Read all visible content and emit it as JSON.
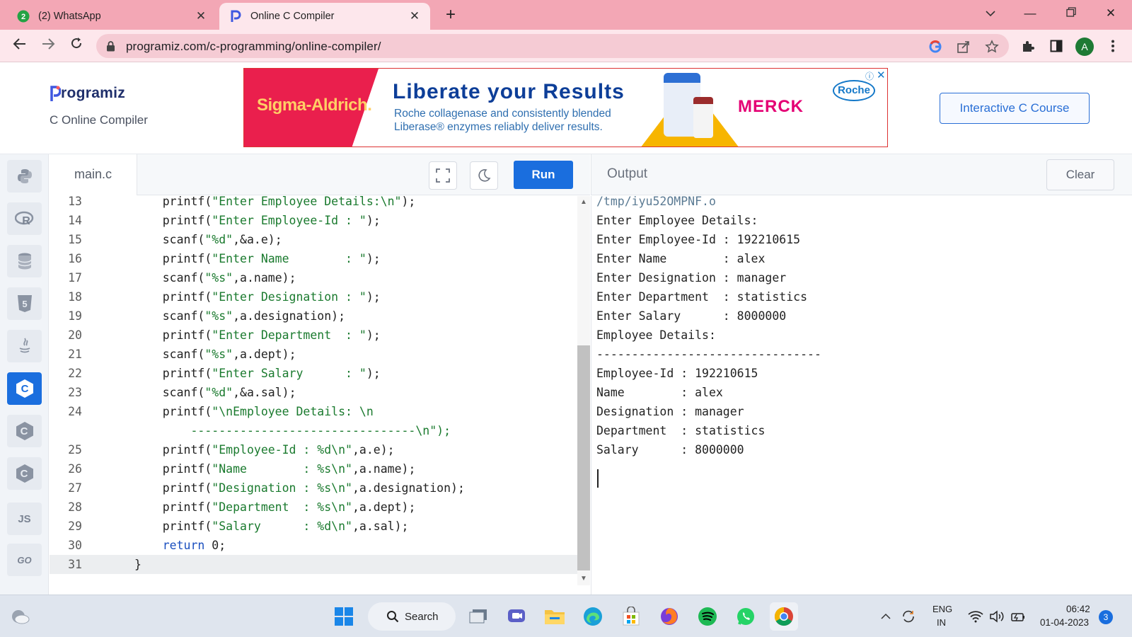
{
  "browser": {
    "tabs": [
      {
        "badge": "2",
        "title": "(2) WhatsApp"
      },
      {
        "title": "Online C Compiler"
      }
    ],
    "url": "programiz.com/c-programming/online-compiler/",
    "profile_initial": "A"
  },
  "site": {
    "logo_text": "rogramiz",
    "logo_letter": "P",
    "subtitle": "C Online Compiler",
    "course_button": "Interactive C Course",
    "ad": {
      "brand_left": "Sigma-Aldrich.",
      "headline": "Liberate your Results",
      "line1": "Roche collagenase and consistently blended",
      "line2": "Liberase® enzymes reliably deliver results.",
      "brand_right": "MERCK",
      "roche": "Roche"
    }
  },
  "sidebar": {
    "items": [
      {
        "name": "python",
        "label": ""
      },
      {
        "name": "r",
        "label": "R"
      },
      {
        "name": "sql",
        "label": ""
      },
      {
        "name": "html",
        "label": "5"
      },
      {
        "name": "java",
        "label": ""
      },
      {
        "name": "c",
        "label": "C",
        "active": true
      },
      {
        "name": "cpp",
        "label": "C"
      },
      {
        "name": "csharp",
        "label": "C"
      },
      {
        "name": "js",
        "label": "JS"
      },
      {
        "name": "go",
        "label": "GO"
      }
    ]
  },
  "editor": {
    "file_name": "main.c",
    "run_label": "Run",
    "lines": [
      {
        "n": "13",
        "code": "    printf(\"Enter Employee Details:\\n\");"
      },
      {
        "n": "14",
        "code": "    printf(\"Enter Employee-Id : \");"
      },
      {
        "n": "15",
        "code": "    scanf(\"%d\",&a.e);"
      },
      {
        "n": "16",
        "code": "    printf(\"Enter Name        : \");"
      },
      {
        "n": "17",
        "code": "    scanf(\"%s\",a.name);"
      },
      {
        "n": "18",
        "code": "    printf(\"Enter Designation : \");"
      },
      {
        "n": "19",
        "code": "    scanf(\"%s\",a.designation);"
      },
      {
        "n": "20",
        "code": "    printf(\"Enter Department  : \");"
      },
      {
        "n": "21",
        "code": "    scanf(\"%s\",a.dept);"
      },
      {
        "n": "22",
        "code": "    printf(\"Enter Salary      : \");"
      },
      {
        "n": "23",
        "code": "    scanf(\"%d\",&a.sal);"
      },
      {
        "n": "24",
        "code": "    printf(\"\\nEmployee Details: \\n"
      },
      {
        "n": "",
        "code": "        --------------------------------\\n\");"
      },
      {
        "n": "25",
        "code": "    printf(\"Employee-Id : %d\\n\",a.e);"
      },
      {
        "n": "26",
        "code": "    printf(\"Name        : %s\\n\",a.name);"
      },
      {
        "n": "27",
        "code": "    printf(\"Designation : %s\\n\",a.designation);"
      },
      {
        "n": "28",
        "code": "    printf(\"Department  : %s\\n\",a.dept);"
      },
      {
        "n": "29",
        "code": "    printf(\"Salary      : %d\\n\",a.sal);"
      },
      {
        "n": "30",
        "code": "    return 0;"
      },
      {
        "n": "31",
        "code": "}"
      }
    ]
  },
  "output": {
    "title": "Output",
    "clear_label": "Clear",
    "lines": [
      "/tmp/iyu52OMPNF.o",
      "Enter Employee Details:",
      "Enter Employee-Id : 192210615",
      "Enter Name        : alex",
      "Enter Designation : manager",
      "Enter Department  : statistics",
      "Enter Salary      : 8000000",
      "Employee Details:",
      "--------------------------------",
      "Employee-Id : 192210615",
      "Name        : alex",
      "Designation : manager",
      "Department  : statistics",
      "Salary      : 8000000"
    ]
  },
  "taskbar": {
    "search_label": "Search",
    "lang_line1": "ENG",
    "lang_line2": "IN",
    "time": "06:42",
    "date": "01-04-2023",
    "notifications": "3"
  },
  "colors": {
    "accent": "#1a6ede",
    "tabbar": "#f3a7b5",
    "toolbar": "#fde7ec",
    "code_string": "#1a7a2e",
    "code_keyword": "#1a4fbf"
  }
}
